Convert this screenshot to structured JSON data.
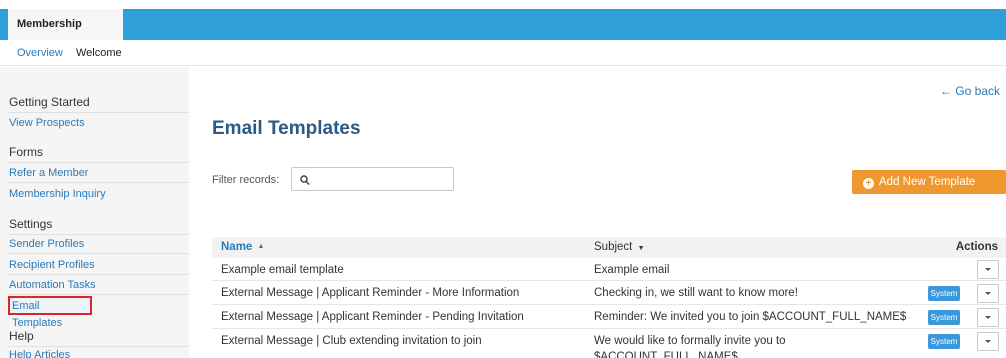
{
  "header": {
    "app_tab": "Membership Success"
  },
  "subnav": {
    "items": [
      "Overview",
      "Welcome"
    ]
  },
  "sidebar": {
    "sections": [
      {
        "heading": "Getting Started",
        "links": [
          "View Prospects"
        ]
      },
      {
        "heading": "Forms",
        "links": [
          "Refer a Member",
          "Membership Inquiry"
        ]
      },
      {
        "heading": "Settings",
        "links": [
          "Sender Profiles",
          "Recipient Profiles",
          "Automation Tasks",
          "Email Templates"
        ]
      },
      {
        "heading": "Help",
        "links": [
          "Help Articles"
        ]
      }
    ],
    "active_link": "Email Templates"
  },
  "main": {
    "go_back": "← Go back",
    "title": "Email Templates",
    "filter_label": "Filter records:",
    "filter_value": "",
    "add_button": "Add New Template",
    "accent_color": "#f0982f"
  },
  "table": {
    "columns": {
      "name": "Name",
      "subject": "Subject",
      "actions": "Actions"
    },
    "sort_up_icon": "▲",
    "sort_down_icon": "▼",
    "rows": [
      {
        "name": "Example email template",
        "subject": "Example email",
        "badge": ""
      },
      {
        "name": "External Message | Applicant Reminder - More Information",
        "subject": "Checking in, we still want to know more!",
        "badge": "System"
      },
      {
        "name": "External Message | Applicant Reminder - Pending Invitation",
        "subject": "Reminder: We invited you to join $ACCOUNT_FULL_NAME$",
        "badge": "System"
      },
      {
        "name": "External Message | Club extending invitation to join",
        "subject": "We would like to formally invite you to",
        "subject_line2": "$ACCOUNT_FULL_NAME$",
        "badge": "System"
      }
    ]
  }
}
